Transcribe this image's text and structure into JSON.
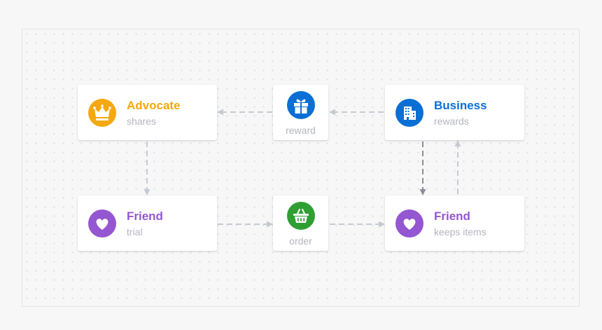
{
  "colors": {
    "advocate": "#f5a80f",
    "business": "#0a6fd4",
    "friend": "#9556d1",
    "order": "#2f9e33",
    "reward": "#0a6fd4",
    "arrow": "#c6c9d1",
    "arrow_dark": "#8a8e9a"
  },
  "nodes": {
    "advocate": {
      "title": "Advocate",
      "subtitle": "shares",
      "icon": "crown-icon"
    },
    "reward": {
      "label": "reward",
      "icon": "gift-icon"
    },
    "business": {
      "title": "Business",
      "subtitle": "rewards",
      "icon": "building-icon"
    },
    "friend_trial": {
      "title": "Friend",
      "subtitle": "trial",
      "icon": "heart-icon"
    },
    "order": {
      "label": "order",
      "icon": "basket-icon"
    },
    "friend_keeps": {
      "title": "Friend",
      "subtitle": "keeps items",
      "icon": "heart-icon"
    }
  },
  "edges": [
    {
      "from": "business",
      "to": "reward"
    },
    {
      "from": "reward",
      "to": "advocate"
    },
    {
      "from": "advocate",
      "to": "friend_trial"
    },
    {
      "from": "friend_trial",
      "to": "order"
    },
    {
      "from": "order",
      "to": "friend_keeps"
    },
    {
      "from": "business",
      "to": "friend_keeps"
    },
    {
      "from": "friend_keeps",
      "to": "business"
    }
  ]
}
